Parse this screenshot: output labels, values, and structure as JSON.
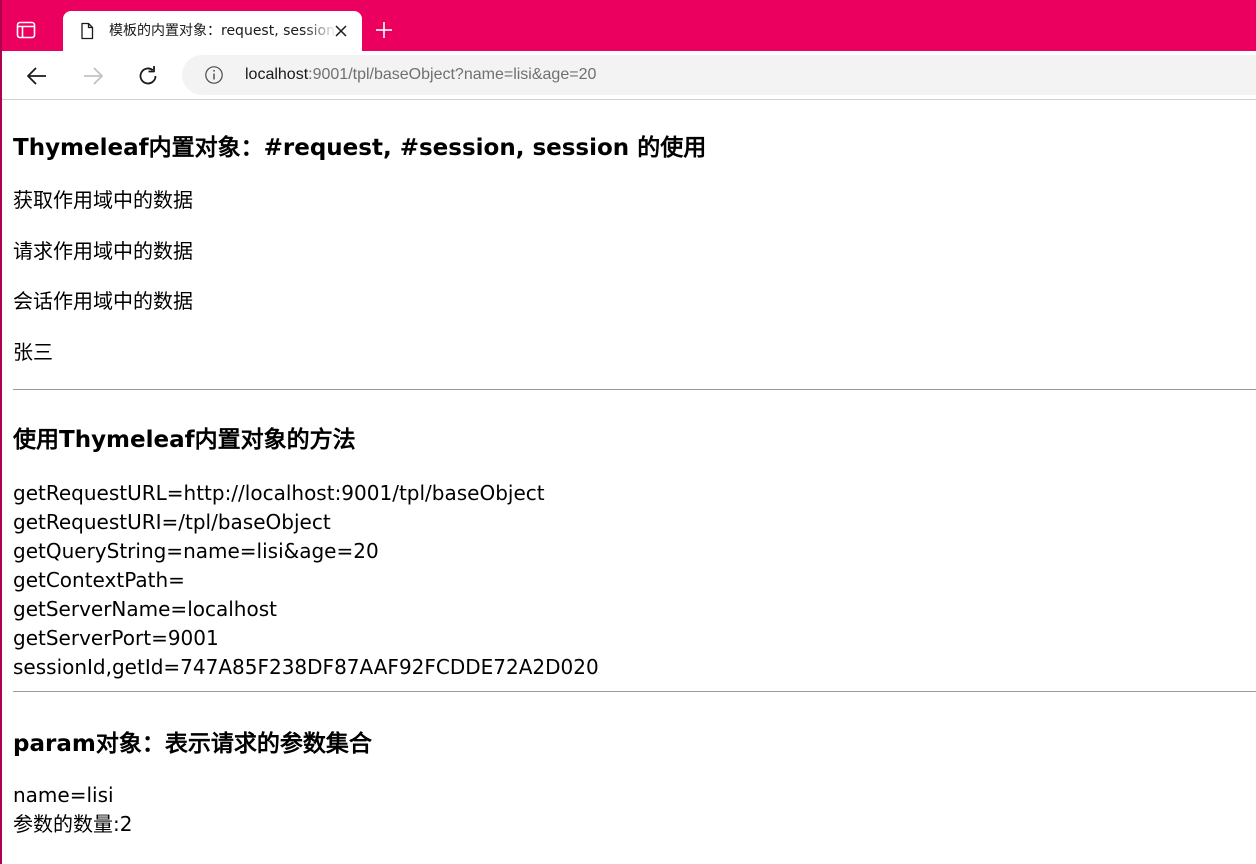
{
  "browser": {
    "tab": {
      "title": "模板的内置对象：request, session"
    },
    "address": {
      "host": "localhost",
      "rest": ":9001/tpl/baseObject?name=lisi&age=20"
    },
    "theme_color": "#eb0060"
  },
  "page": {
    "section1": {
      "heading": "Thymeleaf内置对象：#request, #session, session 的使用",
      "lines": [
        "获取作用域中的数据",
        "请求作用域中的数据",
        "会话作用域中的数据",
        "张三"
      ]
    },
    "section2": {
      "heading": "使用Thymeleaf内置对象的方法",
      "lines": [
        "getRequestURL=http://localhost:9001/tpl/baseObject",
        "getRequestURI=/tpl/baseObject",
        "getQueryString=name=lisi&age=20",
        "getContextPath=",
        "getServerName=localhost",
        "getServerPort=9001",
        "sessionId,getId=747A85F238DF87AAF92FCDDE72A2D020"
      ]
    },
    "section3": {
      "heading": "param对象：表示请求的参数集合",
      "lines": [
        "name=lisi",
        "参数的数量:2"
      ]
    }
  },
  "icons": {
    "tab_actions": "tab-actions-icon",
    "page": "page-icon",
    "close": "close-icon",
    "new_tab": "plus-icon",
    "back": "back-arrow-icon",
    "forward": "forward-arrow-icon",
    "reload": "reload-icon",
    "info": "info-icon"
  }
}
